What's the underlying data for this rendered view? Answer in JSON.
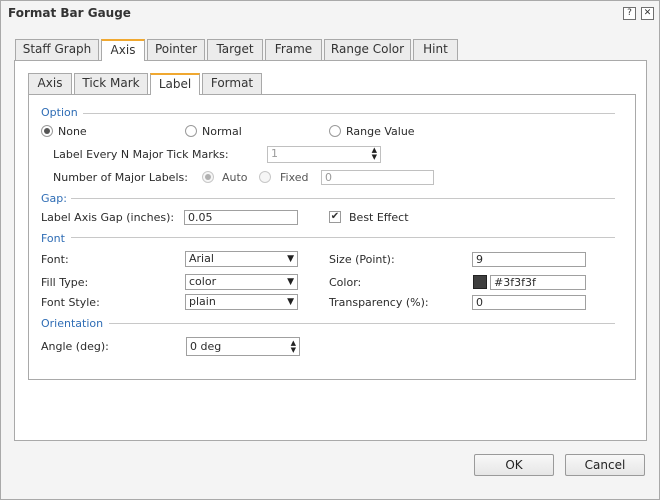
{
  "window": {
    "title": "Format Bar Gauge",
    "help_glyph": "?",
    "close_glyph": "✕"
  },
  "main_tabs": [
    {
      "label": "Staff Graph"
    },
    {
      "label": "Axis"
    },
    {
      "label": "Pointer"
    },
    {
      "label": "Target"
    },
    {
      "label": "Frame"
    },
    {
      "label": "Range Color"
    },
    {
      "label": "Hint"
    }
  ],
  "sub_tabs": [
    {
      "label": "Axis"
    },
    {
      "label": "Tick Mark"
    },
    {
      "label": "Label"
    },
    {
      "label": "Format"
    }
  ],
  "option": {
    "heading": "Option",
    "none_label": "None",
    "normal_label": "Normal",
    "range_label": "Range Value",
    "selected": "None",
    "every_n_label": "Label Every N Major Tick Marks:",
    "every_n_value": "1",
    "num_labels_label": "Number of Major Labels:",
    "auto_label": "Auto",
    "fixed_label": "Fixed",
    "fixed_value": "0"
  },
  "gap": {
    "heading": "Gap:",
    "axis_gap_label": "Label Axis Gap (inches):",
    "axis_gap_value": "0.05",
    "best_effect_label": "Best Effect",
    "best_effect_checked": true
  },
  "font": {
    "heading": "Font",
    "font_label": "Font:",
    "font_value": "Arial",
    "size_label": "Size (Point):",
    "size_value": "9",
    "fill_type_label": "Fill Type:",
    "fill_type_value": "color",
    "color_label": "Color:",
    "color_value": "#3f3f3f",
    "font_style_label": "Font Style:",
    "font_style_value": "plain",
    "transparency_label": "Transparency (%):",
    "transparency_value": "0"
  },
  "orientation": {
    "heading": "Orientation",
    "angle_label": "Angle (deg):",
    "angle_value": "0 deg"
  },
  "buttons": {
    "ok": "OK",
    "cancel": "Cancel"
  },
  "icons": {
    "dropdown": "▼",
    "spin_up": "▲",
    "spin_down": "▼",
    "check": "✔"
  },
  "colors": {
    "accent": "#f0a830",
    "section_heading": "#2f6db5",
    "swatch": "#3f3f3f"
  }
}
